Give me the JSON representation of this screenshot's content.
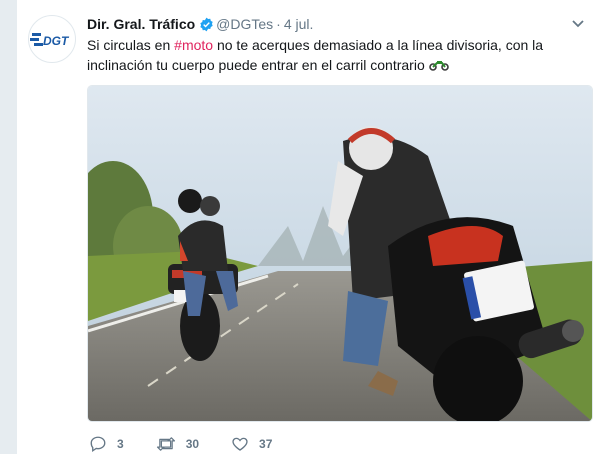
{
  "tweet": {
    "author_name": "Dir. Gral. Tráfico",
    "handle": "@DGTes",
    "separator": "·",
    "time": "4 jul.",
    "avatar_text": "DGT",
    "text_before": "Si circulas en ",
    "hashtag": "#moto",
    "text_after": " no te acerques demasiado a la línea divisoria, con la inclinación tu cuerpo  puede entrar en el carril contrario ",
    "emoji_icon": "motorcycle-icon",
    "image_icon": "photo-motorcyclists-on-road",
    "replies": "3",
    "retweets": "30",
    "likes": "37"
  },
  "colors": {
    "brand_blue": "#1da1f2",
    "hashtag": "#e0245e",
    "dgt_blue": "#1b5aa6",
    "muted": "#657786"
  }
}
